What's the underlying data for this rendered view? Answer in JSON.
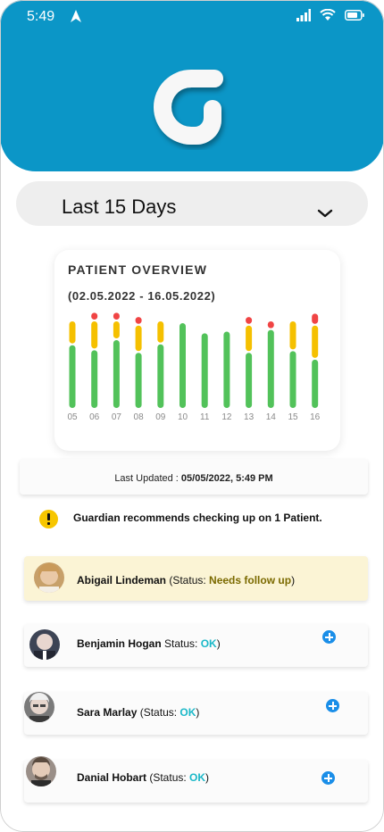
{
  "status_bar": {
    "time": "5:49"
  },
  "range_selector": {
    "label": "Last 15 Days"
  },
  "overview": {
    "title": "PATIENT OVERVIEW",
    "subtitle": "(02.05.2022 - 16.05.2022)"
  },
  "chart_data": {
    "type": "bar",
    "categories": [
      "05",
      "06",
      "07",
      "08",
      "09",
      "10",
      "11",
      "12",
      "13",
      "14",
      "15",
      "16"
    ],
    "series": [
      {
        "values": [
          0.74,
          0.68,
          0.8,
          0.65,
          0.75,
          1.0,
          0.88,
          0.9,
          0.65,
          0.92,
          0.67,
          0.57
        ]
      },
      {
        "values": [
          0.26,
          0.32,
          0.2,
          0.3,
          0.25,
          0.0,
          0.0,
          0.0,
          0.3,
          0.0,
          0.33,
          0.38
        ]
      },
      {
        "values": [
          0.0,
          0.08,
          0.08,
          0.08,
          0.0,
          0.0,
          0.0,
          0.0,
          0.08,
          0.08,
          0.0,
          0.12
        ]
      }
    ],
    "colors": {
      "ok": "#52c25a",
      "warn": "#f5c000",
      "critical": "#f04444"
    }
  },
  "last_updated": {
    "label": "Last Updated : ",
    "value": "05/05/2022, 5:49 PM"
  },
  "recommendation": {
    "text": "Guardian recommends checking up on 1 Patient."
  },
  "patients": [
    {
      "name": "Abigail Lindeman",
      "pre": " (Status: ",
      "status": "Needs follow up",
      "post": ")"
    },
    {
      "name": "Benjamin Hogan",
      "pre": " Status: ",
      "status": "OK",
      "post": ")"
    },
    {
      "name": "Sara Marlay",
      "pre": " (Status: ",
      "status": "OK",
      "post": ")"
    },
    {
      "name": "Danial Hobart",
      "pre": " (Status: ",
      "status": "OK",
      "post": ")"
    }
  ],
  "colors": {
    "header": "#0b96c7",
    "ok_status": "#1bb8c8",
    "alert_bg": "#fbf4d5",
    "add_button": "#1a8ee8"
  }
}
